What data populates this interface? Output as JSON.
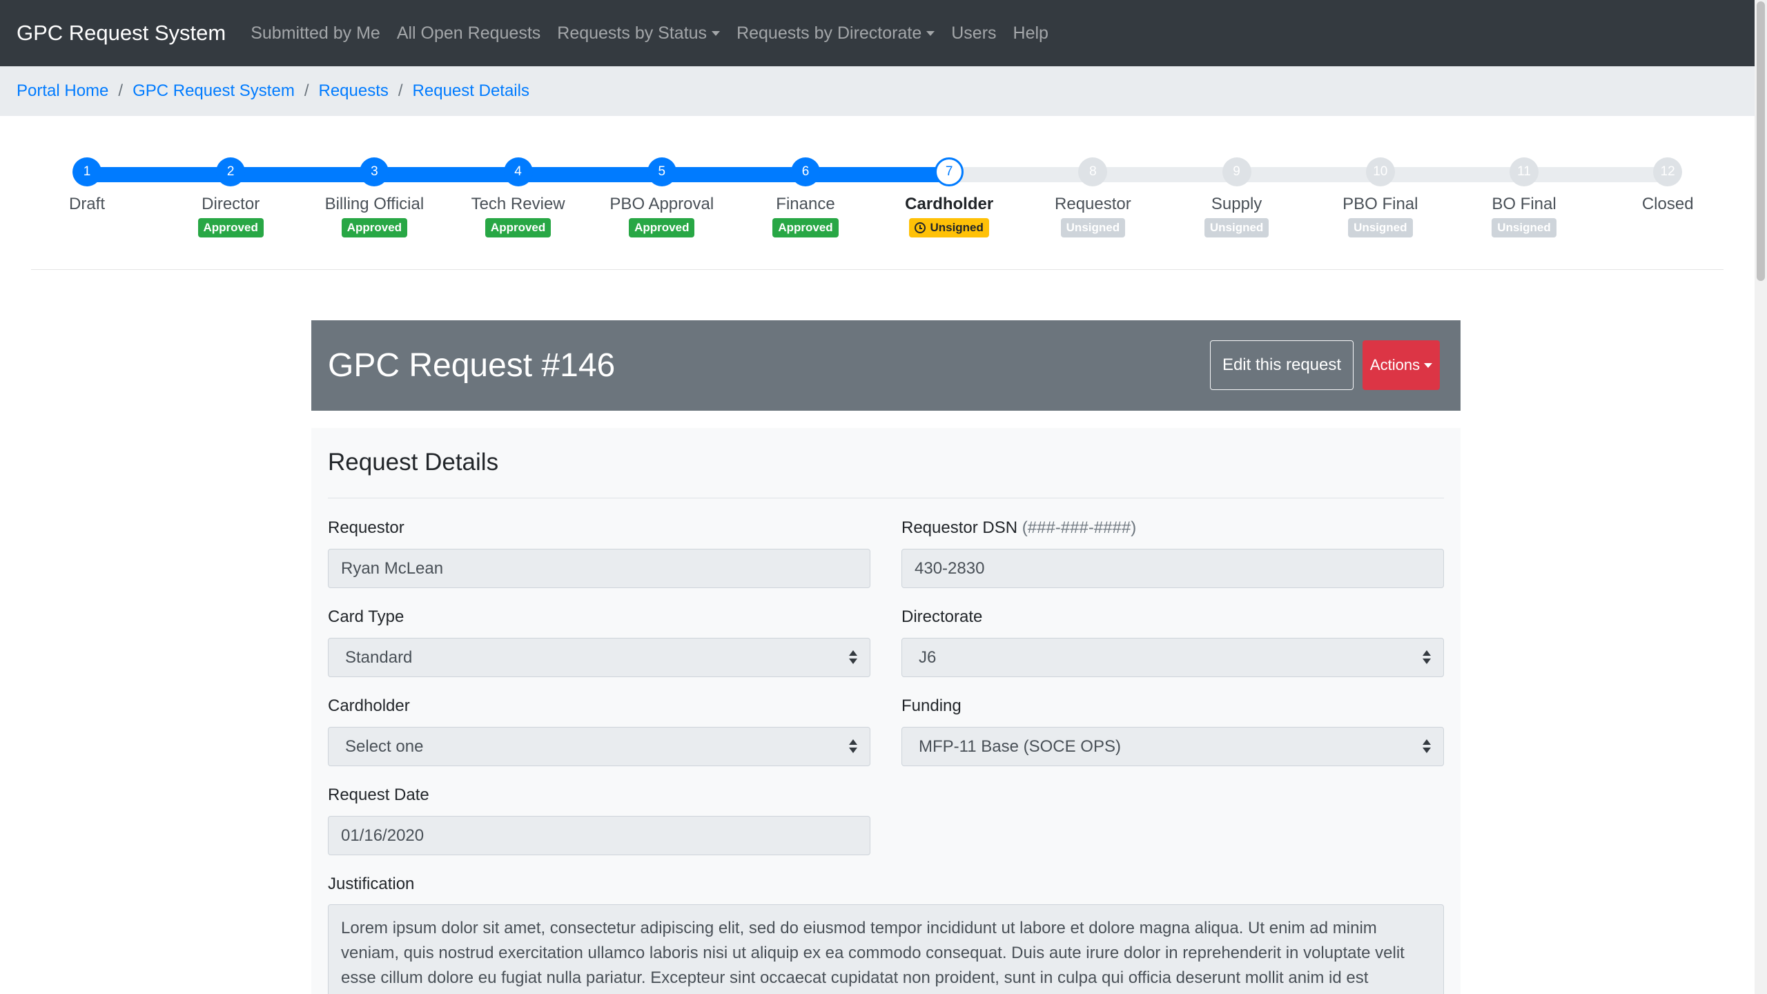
{
  "navbar": {
    "brand": "GPC Request System",
    "items": [
      {
        "label": "Submitted by Me",
        "dropdown": false
      },
      {
        "label": "All Open Requests",
        "dropdown": false
      },
      {
        "label": "Requests by Status",
        "dropdown": true
      },
      {
        "label": "Requests by Directorate",
        "dropdown": true
      },
      {
        "label": "Users",
        "dropdown": false
      },
      {
        "label": "Help",
        "dropdown": false
      }
    ]
  },
  "breadcrumb": [
    "Portal Home",
    "GPC Request System",
    "Requests",
    "Request Details"
  ],
  "stepper": {
    "steps": [
      {
        "number": "1",
        "label": "Draft",
        "state": "done",
        "badge": ""
      },
      {
        "number": "2",
        "label": "Director",
        "state": "done",
        "badge": "Approved"
      },
      {
        "number": "3",
        "label": "Billing Official",
        "state": "done",
        "badge": "Approved"
      },
      {
        "number": "4",
        "label": "Tech Review",
        "state": "done",
        "badge": "Approved"
      },
      {
        "number": "5",
        "label": "PBO Approval",
        "state": "done",
        "badge": "Approved"
      },
      {
        "number": "6",
        "label": "Finance",
        "state": "done",
        "badge": "Approved"
      },
      {
        "number": "7",
        "label": "Cardholder",
        "state": "current",
        "badge": "Unsigned"
      },
      {
        "number": "8",
        "label": "Requestor",
        "state": "todo",
        "badge": "Unsigned"
      },
      {
        "number": "9",
        "label": "Supply",
        "state": "todo",
        "badge": "Unsigned"
      },
      {
        "number": "10",
        "label": "PBO Final",
        "state": "todo",
        "badge": "Unsigned"
      },
      {
        "number": "11",
        "label": "BO Final",
        "state": "todo",
        "badge": "Unsigned"
      },
      {
        "number": "12",
        "label": "Closed",
        "state": "todo",
        "badge": ""
      }
    ]
  },
  "request": {
    "title": "GPC Request #146",
    "edit_label": "Edit this request",
    "actions_label": "Actions"
  },
  "details": {
    "heading": "Request Details",
    "requestor_label": "Requestor",
    "requestor_value": "Ryan McLean",
    "dsn_label": "Requestor DSN",
    "dsn_hint": "(###-###-####)",
    "dsn_value": "430-2830",
    "card_type_label": "Card Type",
    "card_type_value": "Standard",
    "directorate_label": "Directorate",
    "directorate_value": "J6",
    "cardholder_label": "Cardholder",
    "cardholder_value": "Select one",
    "funding_label": "Funding",
    "funding_value": "MFP-11 Base (SOCE OPS)",
    "request_date_label": "Request Date",
    "request_date_value": "01/16/2020",
    "justification_label": "Justification",
    "justification_value": "Lorem ipsum dolor sit amet, consectetur adipiscing elit, sed do eiusmod tempor incididunt ut labore et dolore magna aliqua. Ut enim ad minim veniam, quis nostrud exercitation ullamco laboris nisi ut aliquip ex ea commodo consequat. Duis aute irure dolor in reprehenderit in voluptate velit esse cillum dolore eu fugiat nulla pariatur. Excepteur sint occaecat cupidatat non proident, sunt in culpa qui officia deserunt mollit anim id est laborum."
  },
  "colors": {
    "navbar": "#343a40",
    "primary": "#007bff",
    "success": "#28a745",
    "warning": "#ffc107",
    "danger": "#dc3545",
    "secondary": "#6c757d"
  }
}
